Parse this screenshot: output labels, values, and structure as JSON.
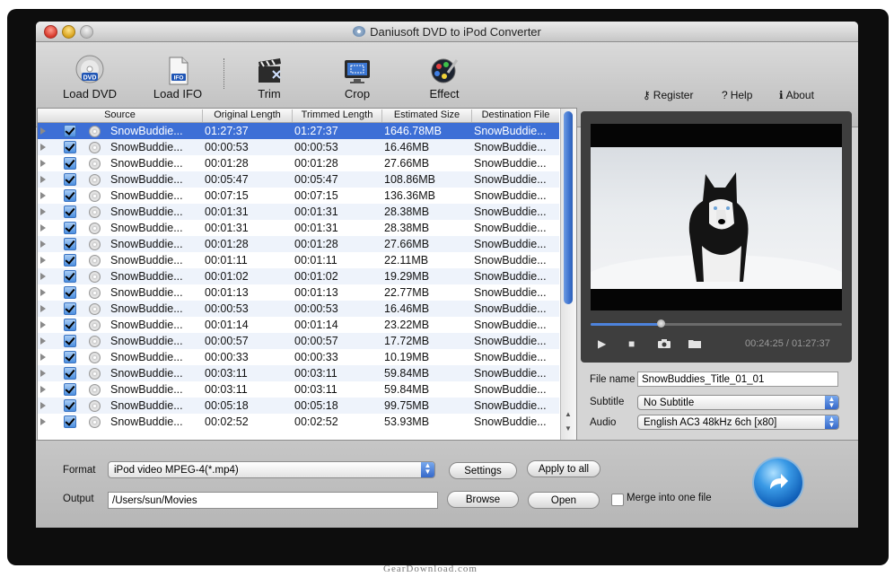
{
  "window": {
    "title": "Daniusoft DVD to iPod Converter"
  },
  "toolbar": {
    "load_dvd": "Load DVD",
    "load_ifo": "Load IFO",
    "trim": "Trim",
    "crop": "Crop",
    "effect": "Effect",
    "register": "Register",
    "help": "Help",
    "about": "About"
  },
  "list": {
    "headers": [
      "Source",
      "Original Length",
      "Trimmed Length",
      "Estimated Size",
      "Destination File"
    ],
    "rows": [
      {
        "source": "SnowBuddie...",
        "original": "01:27:37",
        "trimmed": "01:27:37",
        "size": "1646.78MB",
        "dest": "SnowBuddie..."
      },
      {
        "source": "SnowBuddie...",
        "original": "00:00:53",
        "trimmed": "00:00:53",
        "size": "16.46MB",
        "dest": "SnowBuddie..."
      },
      {
        "source": "SnowBuddie...",
        "original": "00:01:28",
        "trimmed": "00:01:28",
        "size": "27.66MB",
        "dest": "SnowBuddie..."
      },
      {
        "source": "SnowBuddie...",
        "original": "00:05:47",
        "trimmed": "00:05:47",
        "size": "108.86MB",
        "dest": "SnowBuddie..."
      },
      {
        "source": "SnowBuddie...",
        "original": "00:07:15",
        "trimmed": "00:07:15",
        "size": "136.36MB",
        "dest": "SnowBuddie..."
      },
      {
        "source": "SnowBuddie...",
        "original": "00:01:31",
        "trimmed": "00:01:31",
        "size": "28.38MB",
        "dest": "SnowBuddie..."
      },
      {
        "source": "SnowBuddie...",
        "original": "00:01:31",
        "trimmed": "00:01:31",
        "size": "28.38MB",
        "dest": "SnowBuddie..."
      },
      {
        "source": "SnowBuddie...",
        "original": "00:01:28",
        "trimmed": "00:01:28",
        "size": "27.66MB",
        "dest": "SnowBuddie..."
      },
      {
        "source": "SnowBuddie...",
        "original": "00:01:11",
        "trimmed": "00:01:11",
        "size": "22.11MB",
        "dest": "SnowBuddie..."
      },
      {
        "source": "SnowBuddie...",
        "original": "00:01:02",
        "trimmed": "00:01:02",
        "size": "19.29MB",
        "dest": "SnowBuddie..."
      },
      {
        "source": "SnowBuddie...",
        "original": "00:01:13",
        "trimmed": "00:01:13",
        "size": "22.77MB",
        "dest": "SnowBuddie..."
      },
      {
        "source": "SnowBuddie...",
        "original": "00:00:53",
        "trimmed": "00:00:53",
        "size": "16.46MB",
        "dest": "SnowBuddie..."
      },
      {
        "source": "SnowBuddie...",
        "original": "00:01:14",
        "trimmed": "00:01:14",
        "size": "23.22MB",
        "dest": "SnowBuddie..."
      },
      {
        "source": "SnowBuddie...",
        "original": "00:00:57",
        "trimmed": "00:00:57",
        "size": "17.72MB",
        "dest": "SnowBuddie..."
      },
      {
        "source": "SnowBuddie...",
        "original": "00:00:33",
        "trimmed": "00:00:33",
        "size": "10.19MB",
        "dest": "SnowBuddie..."
      },
      {
        "source": "SnowBuddie...",
        "original": "00:03:11",
        "trimmed": "00:03:11",
        "size": "59.84MB",
        "dest": "SnowBuddie..."
      },
      {
        "source": "SnowBuddie...",
        "original": "00:03:11",
        "trimmed": "00:03:11",
        "size": "59.84MB",
        "dest": "SnowBuddie..."
      },
      {
        "source": "SnowBuddie...",
        "original": "00:05:18",
        "trimmed": "00:05:18",
        "size": "99.75MB",
        "dest": "SnowBuddie..."
      },
      {
        "source": "SnowBuddie...",
        "original": "00:02:52",
        "trimmed": "00:02:52",
        "size": "53.93MB",
        "dest": "SnowBuddie..."
      }
    ],
    "selected_index": 0
  },
  "preview": {
    "time": "00:24:25 / 01:27:37",
    "progress": 0.28
  },
  "fields": {
    "file_name_label": "File name",
    "file_name": "SnowBuddies_Title_01_01",
    "subtitle_label": "Subtitle",
    "subtitle": "No Subtitle",
    "audio_label": "Audio",
    "audio": "English AC3 48kHz 6ch [x80]"
  },
  "bottom": {
    "format_label": "Format",
    "format": "iPod video MPEG-4(*.mp4)",
    "settings": "Settings",
    "apply_all": "Apply to all",
    "output_label": "Output",
    "output": "/Users/sun/Movies",
    "browse": "Browse",
    "open": "Open",
    "merge": "Merge into one file"
  },
  "watermark": "GearDownload.com",
  "colors": {
    "selection": "#3d6fd6",
    "accent": "#4d83dc"
  }
}
